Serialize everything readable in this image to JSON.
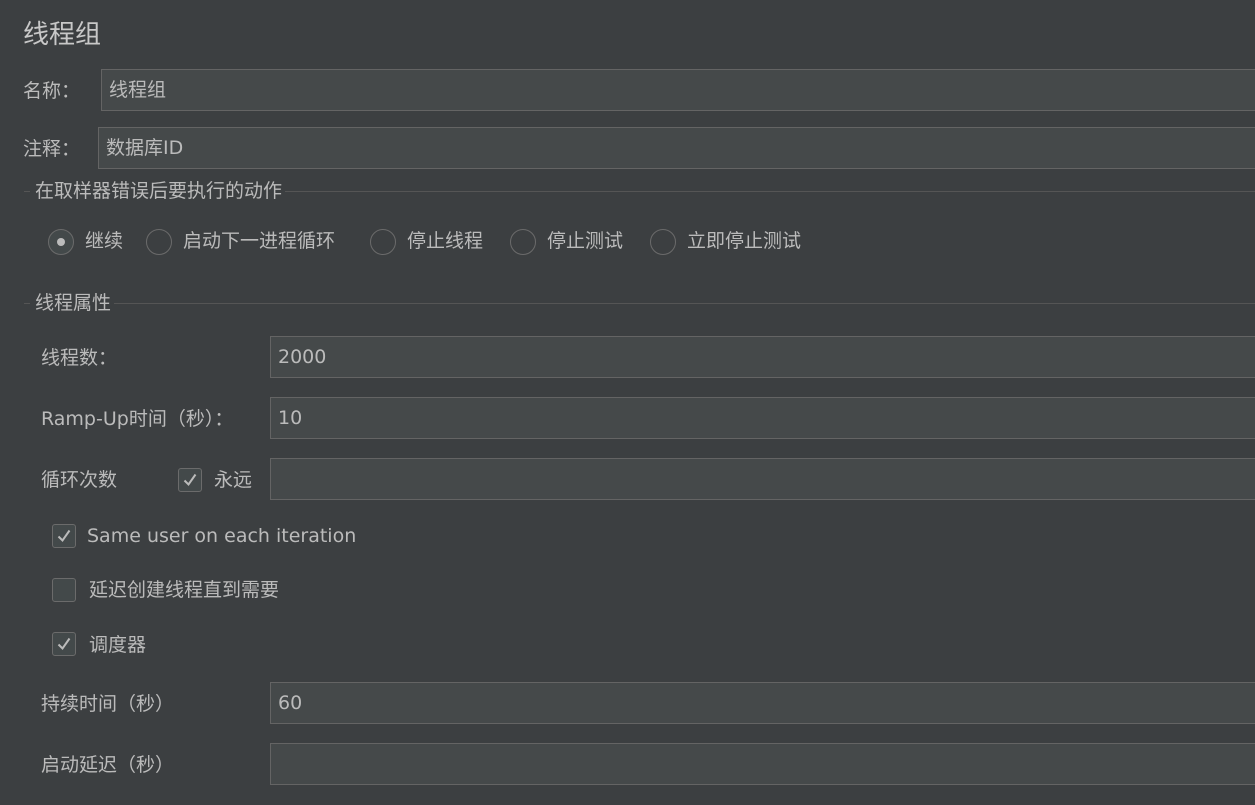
{
  "panel": {
    "title": "线程组",
    "name_label": "名称：",
    "name_value": "线程组",
    "comment_label": "注释：",
    "comment_value": "数据库ID"
  },
  "error_action": {
    "title": "在取样器错误后要执行的动作",
    "options": [
      {
        "label": "继续",
        "selected": true
      },
      {
        "label": "启动下一进程循环",
        "selected": false
      },
      {
        "label": "停止线程",
        "selected": false
      },
      {
        "label": "停止测试",
        "selected": false
      },
      {
        "label": "立即停止测试",
        "selected": false
      }
    ]
  },
  "thread_props": {
    "title": "线程属性",
    "threads_label": "线程数：",
    "threads_value": "2000",
    "rampup_label": "Ramp-Up时间（秒）：",
    "rampup_value": "10",
    "loop_label": "循环次数",
    "forever_label": "永远",
    "forever_checked": true,
    "loop_value": "",
    "same_user_label": "Same user on each iteration",
    "same_user_checked": true,
    "delay_create_label": "延迟创建线程直到需要",
    "delay_create_checked": false,
    "scheduler_label": "调度器",
    "scheduler_checked": true,
    "duration_label": "持续时间（秒）",
    "duration_value": "60",
    "startup_delay_label": "启动延迟（秒）",
    "startup_delay_value": ""
  },
  "colors": {
    "background": "#3c3f41",
    "field_background": "#45494a",
    "field_border": "#646464",
    "text": "#bbbbbb"
  }
}
